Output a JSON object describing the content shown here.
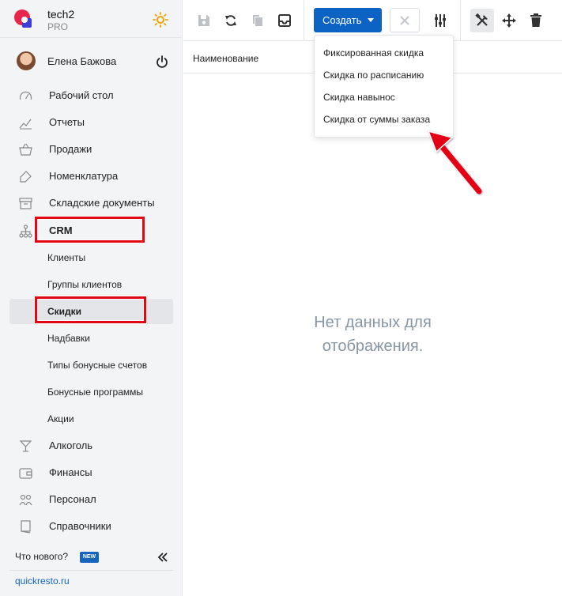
{
  "brand": {
    "name": "tech2",
    "plan": "PRO"
  },
  "user": {
    "name": "Елена Бажова"
  },
  "sidebar": {
    "items": [
      {
        "label": "Рабочий стол",
        "icon": "dashboard-icon"
      },
      {
        "label": "Отчеты",
        "icon": "reports-icon"
      },
      {
        "label": "Продажи",
        "icon": "basket-icon"
      },
      {
        "label": "Номенклатура",
        "icon": "tag-icon"
      },
      {
        "label": "Складские документы",
        "icon": "archive-icon"
      },
      {
        "label": "CRM",
        "icon": "org-chart-icon",
        "expanded": true
      }
    ],
    "crm_sub": [
      {
        "label": "Клиенты"
      },
      {
        "label": "Группы клиентов"
      },
      {
        "label": "Скидки",
        "active": true
      },
      {
        "label": "Надбавки"
      },
      {
        "label": "Типы бонусные счетов"
      },
      {
        "label": "Бонусные программы"
      },
      {
        "label": "Акции"
      }
    ],
    "items_after": [
      {
        "label": "Алкоголь",
        "icon": "glass-icon"
      },
      {
        "label": "Финансы",
        "icon": "wallet-icon"
      },
      {
        "label": "Персонал",
        "icon": "people-icon"
      },
      {
        "label": "Справочники",
        "icon": "book-icon"
      }
    ],
    "whats_new": "Что нового?",
    "new_badge": "NEW",
    "site_link": "quickresto.ru"
  },
  "toolbar": {
    "create_label": "Создать"
  },
  "table": {
    "column_header": "Наименование"
  },
  "empty_state": {
    "line1": "Нет данных для",
    "line2": "отображения."
  },
  "create_menu": {
    "items": [
      {
        "label": "Фиксированная скидка"
      },
      {
        "label": "Скидка по расписанию"
      },
      {
        "label": "Скидка навынос"
      },
      {
        "label": "Скидка от суммы заказа"
      }
    ]
  },
  "colors": {
    "primary": "#0d63c4",
    "highlight": "#e30613",
    "link": "#1565c0",
    "empty_text": "#8696a4",
    "sidebar_bg": "#f3f4f6"
  }
}
